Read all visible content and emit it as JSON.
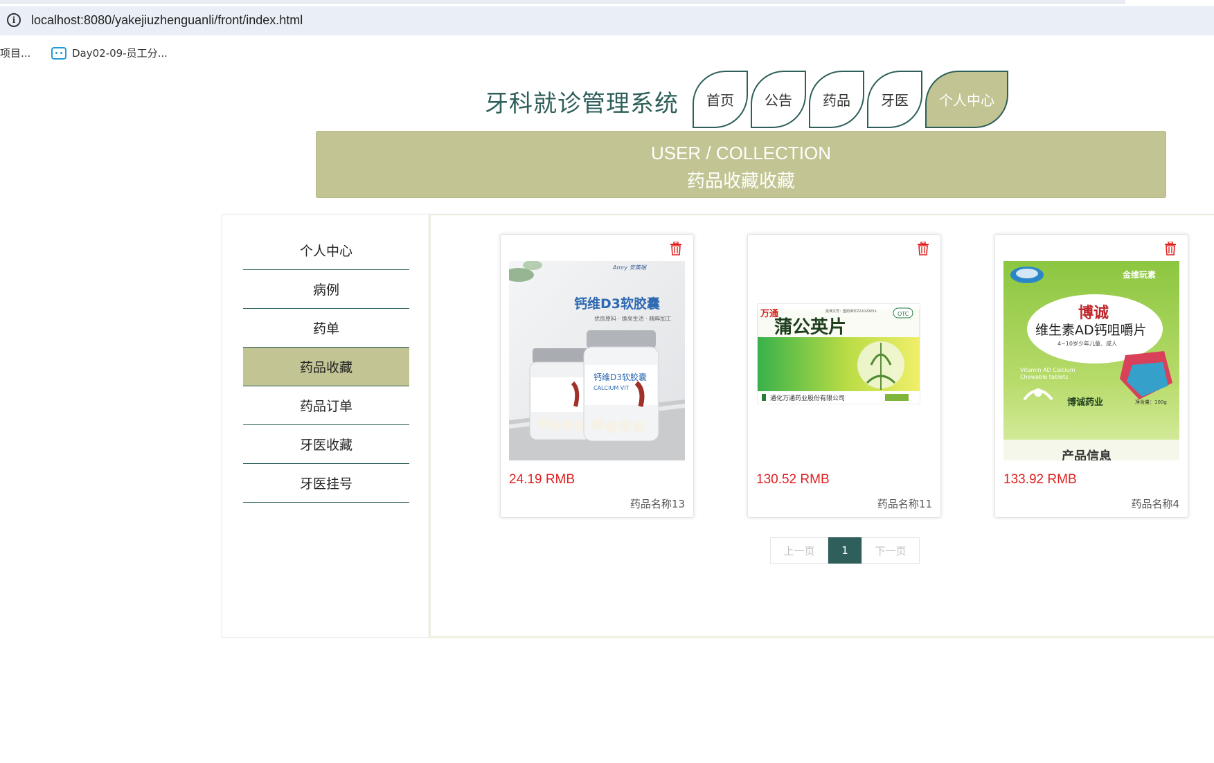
{
  "browser": {
    "info_icon": "info-circle-icon",
    "url": "localhost:8080/yakejiuzhenguanli/front/index.html",
    "bookmarks": [
      {
        "label": "项目..."
      },
      {
        "label": "Day02-09-员工分...",
        "icon": "bilibili-tv-icon"
      }
    ]
  },
  "header": {
    "site_title": "牙科就诊管理系统",
    "nav": [
      {
        "label": "首页"
      },
      {
        "label": "公告"
      },
      {
        "label": "药品"
      },
      {
        "label": "牙医"
      },
      {
        "label": "个人中心",
        "active": true
      }
    ]
  },
  "banner": {
    "en": "USER / COLLECTION",
    "cn": "药品收藏收藏"
  },
  "sidebar": {
    "items": [
      {
        "label": "个人中心"
      },
      {
        "label": "病例"
      },
      {
        "label": "药单"
      },
      {
        "label": "药品收藏",
        "active": true
      },
      {
        "label": "药品订单"
      },
      {
        "label": "牙医收藏"
      },
      {
        "label": "牙医挂号"
      }
    ]
  },
  "collection": {
    "cards": [
      {
        "price": "24.19 RMB",
        "name": "药品名称13",
        "image": {
          "brand": "Amry 安美瑞",
          "title": "钙维D3软胶囊",
          "sub": "优良原料 · 焕亮生活 · 精粹加工",
          "jar_label": "钙维D3软胶囊",
          "jar_en": "CALCIUM VIT"
        }
      },
      {
        "price": "130.52 RMB",
        "name": "药品名称11",
        "image": {
          "brand": "万通",
          "title": "蒲公英片",
          "otc": "OTC",
          "maker": "通化万通药业股份有限公司",
          "approval": "批准文号：国药准字Z22020051"
        }
      },
      {
        "price": "133.92 RMB",
        "name": "药品名称4",
        "image": {
          "brand_top": "金维玩素",
          "title_1": "博诚",
          "title_2": "维生素AD钙咀嚼片",
          "age": "4~10岁少年儿童、成人",
          "en_1": "Vitamin AD Calcium",
          "en_2": "Chewable tablets",
          "maker": "博诚药业",
          "footer": "产品信息",
          "weight": "净含量：100g"
        }
      }
    ],
    "trash_icon": "trash-icon"
  },
  "pagination": {
    "prev": "上一页",
    "current": "1",
    "next": "下一页"
  },
  "colors": {
    "accent_dark": "#2e5f5a",
    "accent_light": "#c2c593",
    "price": "#e02020"
  }
}
